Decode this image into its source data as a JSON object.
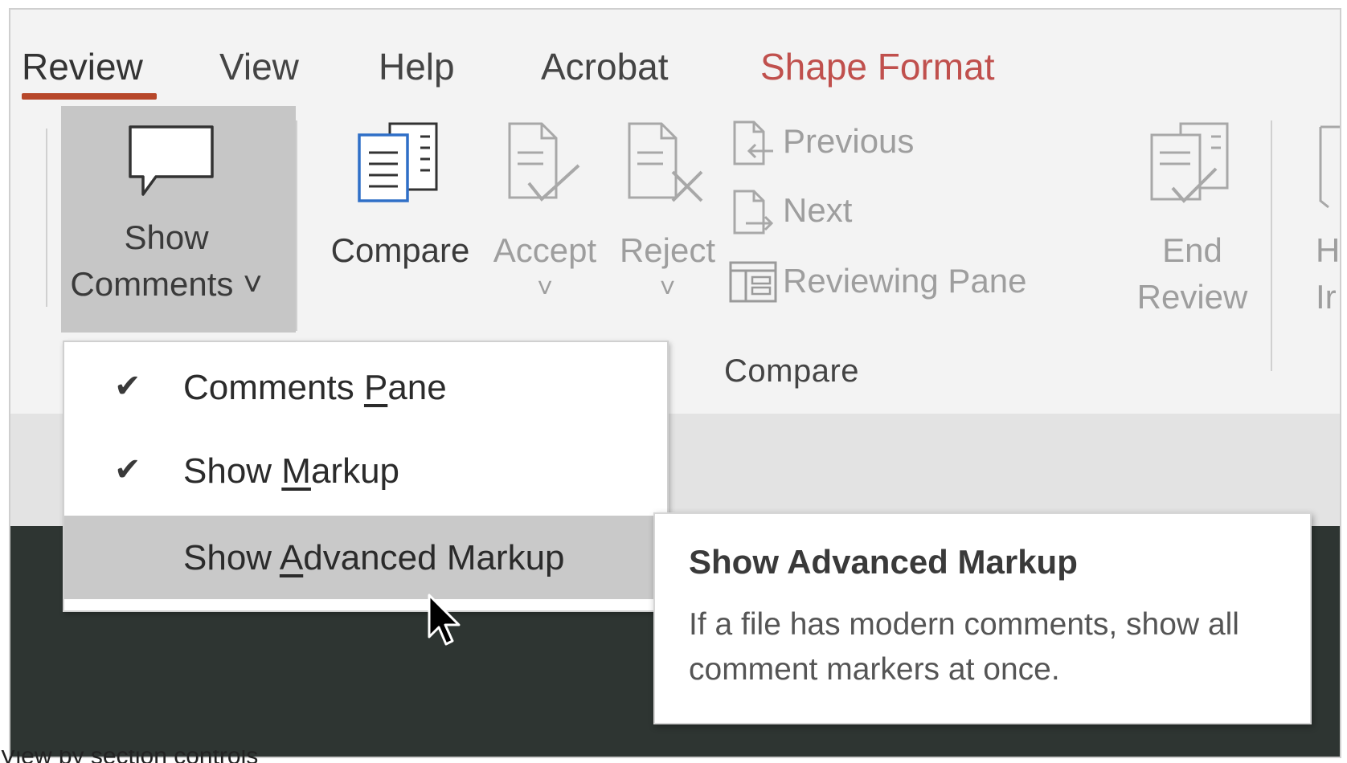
{
  "tabs": [
    {
      "label": "Review",
      "active": true
    },
    {
      "label": "View"
    },
    {
      "label": "Help"
    },
    {
      "label": "Acrobat"
    },
    {
      "label": "Shape Format",
      "accent": "#c0504d"
    }
  ],
  "ribbon": {
    "show_comments": {
      "line1": "Show",
      "line2": "Comments ˅",
      "icon": "speech-bubble-icon"
    },
    "compare": {
      "label": "Compare",
      "icon": "compare-documents-icon"
    },
    "accept": {
      "label": "Accept",
      "arrow": "˅",
      "icon": "accept-document-icon"
    },
    "reject": {
      "label": "Reject",
      "arrow": "˅",
      "icon": "reject-document-icon"
    },
    "previous": {
      "label": "Previous",
      "icon": "previous-change-icon"
    },
    "next": {
      "label": "Next",
      "icon": "next-change-icon"
    },
    "reviewing_pane": {
      "label": "Reviewing Pane",
      "icon": "reviewing-pane-icon"
    },
    "end_review": {
      "line1": "End",
      "line2": "Review",
      "icon": "end-review-icon"
    },
    "partial": {
      "line1": "H",
      "line2": "Ir"
    },
    "group_label": "Compare"
  },
  "menu": {
    "items": [
      {
        "pre": "Comments ",
        "accel": "P",
        "post": "ane",
        "checked": true,
        "check": "✔"
      },
      {
        "pre": "Show ",
        "accel": "M",
        "post": "arkup",
        "checked": true,
        "check": "✔"
      },
      {
        "pre": "Show ",
        "accel": "A",
        "post": "dvanced Markup",
        "checked": false,
        "hover": true
      }
    ]
  },
  "tooltip": {
    "title": "Show Advanced Markup",
    "description": "If a file has modern comments, show all comment markers at once."
  },
  "caption": "View by section controls",
  "colors": {
    "accent_underline": "#b7472a",
    "shape_format": "#c0504d",
    "doc_bg": "#2e3532"
  }
}
